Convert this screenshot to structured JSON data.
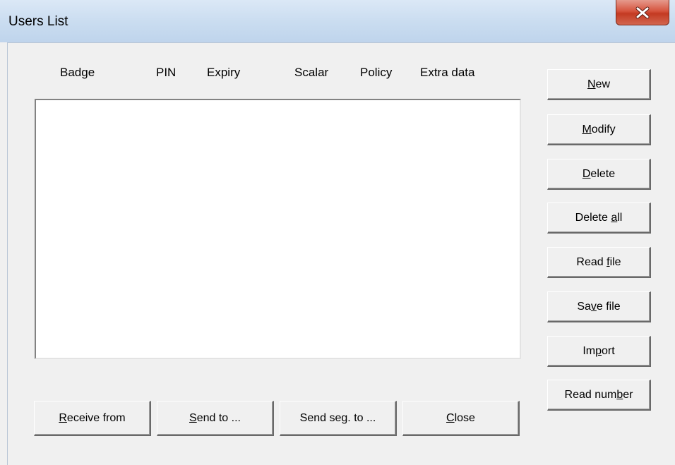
{
  "window": {
    "title": "Users List",
    "close_glyph": "X"
  },
  "columns": [
    "Badge",
    "PIN",
    "Expiry",
    "Scalar",
    "Policy",
    "Extra data"
  ],
  "side_buttons": [
    {
      "pre": "",
      "accel": "N",
      "post": "ew"
    },
    {
      "pre": "",
      "accel": "M",
      "post": "odify"
    },
    {
      "pre": "",
      "accel": "D",
      "post": "elete"
    },
    {
      "pre": "Delete ",
      "accel": "a",
      "post": "ll"
    },
    {
      "pre": "Read ",
      "accel": "f",
      "post": "ile"
    },
    {
      "pre": "Sa",
      "accel": "v",
      "post": "e file"
    },
    {
      "pre": "Im",
      "accel": "p",
      "post": "ort"
    },
    {
      "pre": "Read num",
      "accel": "b",
      "post": "er"
    }
  ],
  "bottom_buttons": [
    {
      "pre": "",
      "accel": "R",
      "post": "eceive from"
    },
    {
      "pre": "",
      "accel": "S",
      "post": "end to ..."
    },
    {
      "pre": "Send se",
      "accel": "g",
      "post": ". to ..."
    },
    {
      "pre": "",
      "accel": "C",
      "post": "lose"
    }
  ],
  "list_rows": []
}
